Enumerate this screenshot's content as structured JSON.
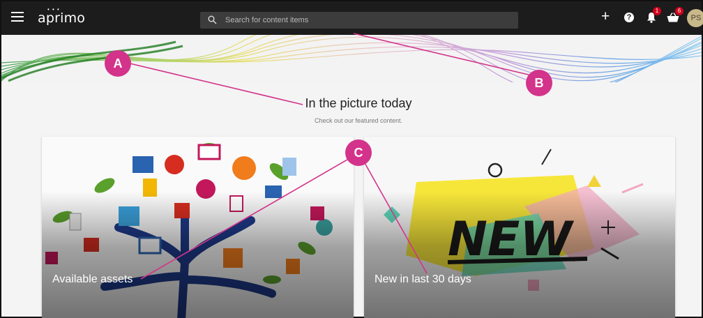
{
  "app": {
    "logo": "aprimo"
  },
  "topbar": {
    "menu_icon": "hamburger-icon",
    "search_icon": "search-icon",
    "search_placeholder": "Search for content items",
    "add_icon": "plus-icon",
    "help_icon": "question-icon",
    "notifications_icon": "bell-icon",
    "notifications_count": "1",
    "basket_icon": "basket-icon",
    "basket_count": "6",
    "avatar_initials": "PS"
  },
  "main": {
    "title": "In the picture today",
    "subtitle": "Check out our featured content."
  },
  "cards": [
    {
      "label": "Available assets"
    },
    {
      "label": "New in last 30 days"
    }
  ],
  "annotations": [
    {
      "label": "A"
    },
    {
      "label": "B"
    },
    {
      "label": "C"
    }
  ],
  "colors": {
    "topbar": "#1c1c1c",
    "annotation": "#d3338a",
    "badge": "#d0021b"
  }
}
